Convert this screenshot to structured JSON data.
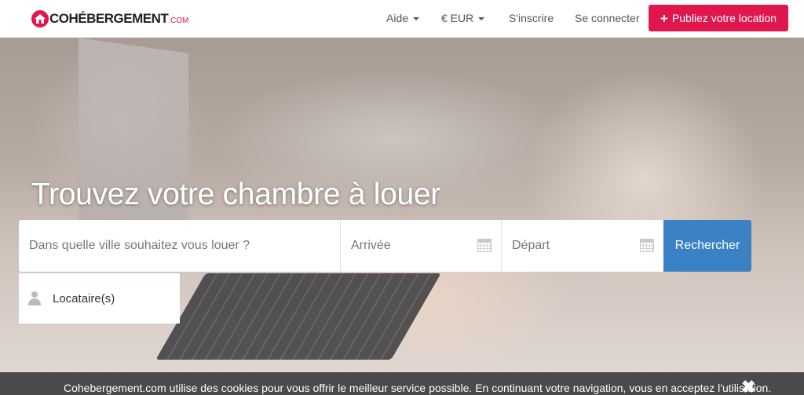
{
  "header": {
    "logo_text": "COHÉBERGEMENT",
    "logo_suffix": ".COM",
    "nav": {
      "help_label": "Aide",
      "currency_label": "€ EUR",
      "signup_label": "S'inscrire",
      "login_label": "Se connecter",
      "publish_label": "Publiez votre location"
    },
    "brand_color": "#e0164f"
  },
  "hero": {
    "headline": "Trouvez votre chambre à louer",
    "search": {
      "city_placeholder": "Dans quelle ville souhaitez vous louer ?",
      "arrival_placeholder": "Arrivée",
      "departure_placeholder": "Départ",
      "search_button_label": "Rechercher",
      "guests_label": "Locataire(s)",
      "button_color": "#3a82c4"
    }
  },
  "cookie_banner": {
    "text": "Cohebergement.com utilise des cookies pour vous offrir le meilleur service possible. En continuant votre navigation, vous en acceptez l'utilisation.",
    "close_icon": "✖"
  }
}
